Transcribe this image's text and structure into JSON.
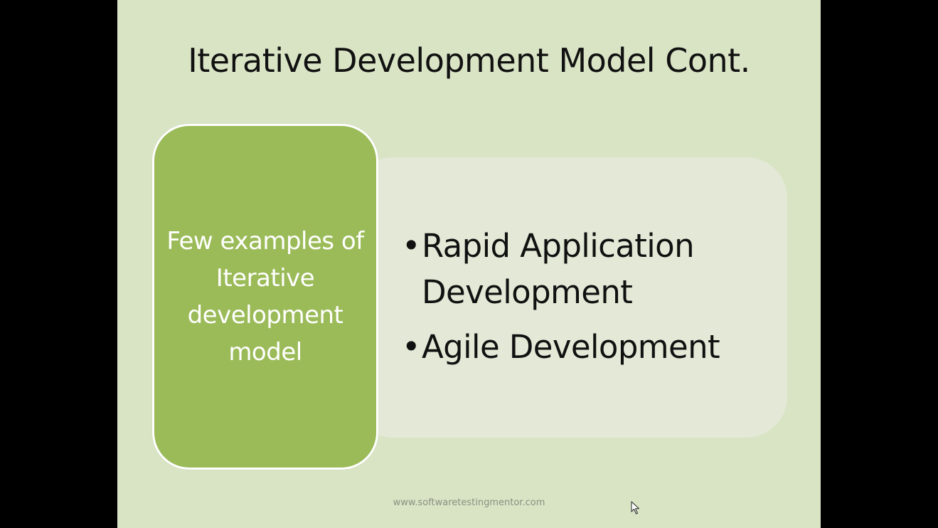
{
  "slide": {
    "title": "Iterative Development Model Cont.",
    "label_box": {
      "text": "Few examples of Iterative development model"
    },
    "bullets": [
      {
        "text": "Rapid Application Development"
      },
      {
        "text": "Agile Development"
      }
    ],
    "bullet_glyph": "•",
    "footer": "www.softwaretestingmentor.com"
  },
  "colors": {
    "slide_background": "#d9e4c5",
    "label_box_fill": "#9bbb59",
    "content_panel_fill": "#e3e9d6",
    "letterbox": "#000000"
  },
  "icons": {
    "cursor": "mouse-pointer-icon"
  }
}
